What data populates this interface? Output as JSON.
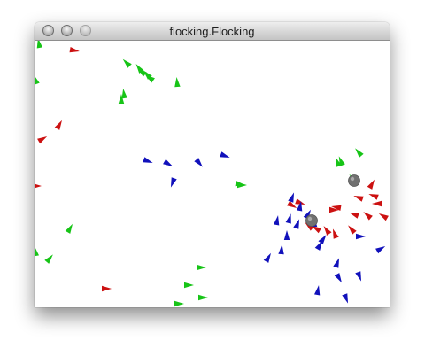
{
  "window": {
    "title": "flocking.Flocking"
  },
  "controls": {
    "close_icon": "close-icon",
    "minimize_icon": "minimize-icon",
    "zoom_icon": "zoom-icon"
  },
  "colors": {
    "green_boid": "#17c417",
    "red_boid": "#cc1111",
    "blue_boid": "#1111bb",
    "obstacle": "#707070",
    "background": "#ffffff"
  },
  "simulation": {
    "boid_counts": {
      "green": 23,
      "red": 21,
      "blue": 24
    },
    "obstacle_count": 2
  }
}
